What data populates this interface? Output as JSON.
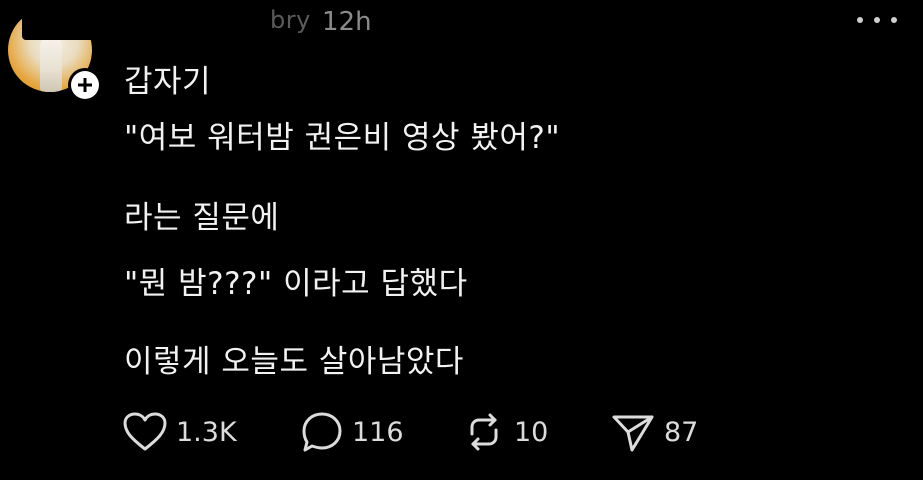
{
  "header": {
    "username_visible_fragment": "bry",
    "timestamp": "12h"
  },
  "post": {
    "lines": [
      "갑자기",
      "\"여보 워터밤 권은비 영상 봤어?\"",
      "라는 질문에",
      "\"뭔 밤???\" 이라고 답했다",
      "이렇게 오늘도 살아남았다"
    ]
  },
  "actions": {
    "like_count": "1.3K",
    "reply_count": "116",
    "repost_count": "10",
    "share_count": "87"
  },
  "icons": {
    "like": "heart-icon",
    "reply": "speech-bubble-icon",
    "repost": "repost-arrows-icon",
    "share": "paper-plane-icon",
    "more": "more-dots-icon",
    "follow": "plus-icon"
  },
  "colors": {
    "background": "#000000",
    "text": "#f2f2f2",
    "secondary_text": "#8a8a8a",
    "avatar_accent": "#e6a43a"
  }
}
